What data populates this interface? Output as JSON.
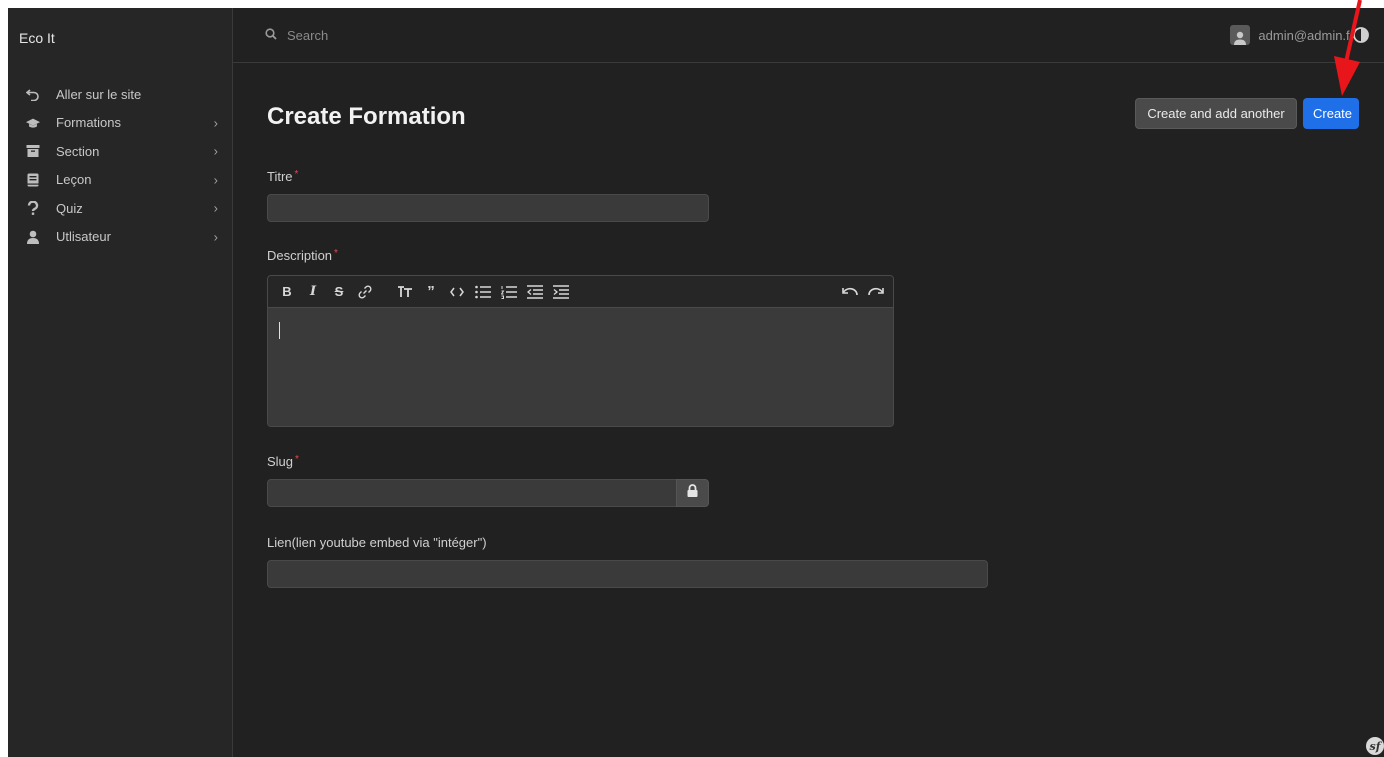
{
  "brand": "Eco It",
  "sidebar": {
    "items": [
      {
        "label": "Aller sur le site",
        "icon": "undo-arrow-icon",
        "chevron": false
      },
      {
        "label": "Formations",
        "icon": "graduation-cap-icon",
        "chevron": true
      },
      {
        "label": "Section",
        "icon": "archive-box-icon",
        "chevron": true
      },
      {
        "label": "Leçon",
        "icon": "book-icon",
        "chevron": true
      },
      {
        "label": "Quiz",
        "icon": "question-icon",
        "chevron": true
      },
      {
        "label": "Utlisateur",
        "icon": "user-icon",
        "chevron": true
      }
    ],
    "chevron_glyph": "›"
  },
  "topbar": {
    "search_placeholder": "Search",
    "user_email": "admin@admin.fr"
  },
  "page": {
    "title": "Create Formation",
    "btn_create_another": "Create and add another",
    "btn_create": "Create"
  },
  "form": {
    "titre_label": "Titre",
    "titre_value": "",
    "description_label": "Description",
    "slug_label": "Slug",
    "slug_value": "",
    "lien_label": "Lien(lien youtube embed via \"intéger\")",
    "lien_value": "",
    "required_mark": "*"
  },
  "editor": {
    "toolbar_left": [
      "B",
      "I",
      "S",
      "link",
      "heading",
      "quote",
      "code",
      "bullet-list",
      "number-list",
      "outdent",
      "indent"
    ],
    "toolbar_right": [
      "undo",
      "redo"
    ]
  },
  "colors": {
    "accent": "#1e6fe8",
    "required": "#e24c4b",
    "annotation_arrow": "#e8151b"
  }
}
